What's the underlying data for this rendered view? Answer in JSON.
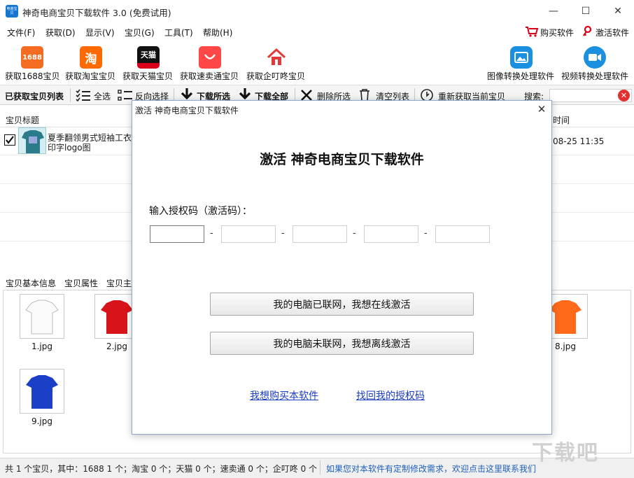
{
  "window": {
    "title": "神奇电商宝贝下载软件 3.0 (免费试用)",
    "logo_text": "电商宝贝",
    "controls": [
      "—",
      "☐",
      "✕"
    ]
  },
  "menu": [
    "文件(F)",
    "获取(D)",
    "显示(V)",
    "宝贝(G)",
    "工具(T)",
    "帮助(H)"
  ],
  "menu_right": {
    "buy": "购买软件",
    "activate": "激活软件"
  },
  "toolbar": {
    "items": [
      {
        "label": "获取1688宝贝",
        "icon_text": "1688",
        "color": "#f36c21"
      },
      {
        "label": "获取淘宝宝贝",
        "icon_text": "淘",
        "color": "#ff6a00"
      },
      {
        "label": "获取天猫宝贝",
        "icon_text": "天猫",
        "color": "#d9001b"
      },
      {
        "label": "获取速卖通宝贝",
        "icon_text": "",
        "color": "#ff4747"
      },
      {
        "label": "获取企叮咚宝贝",
        "icon_text": "",
        "color": "#e23a3a"
      }
    ],
    "right_items": [
      {
        "label": "图像转换处理软件",
        "color": "#1b8fe0"
      },
      {
        "label": "视频转换处理软件",
        "color": "#1b8fe0"
      }
    ]
  },
  "subbar": {
    "list_title": "已获取宝贝列表",
    "select_all": "全选",
    "invert": "反向选择",
    "download_selected": "下载所选",
    "download_all": "下载全部",
    "delete_selected": "删除所选",
    "clear_list": "清空列表",
    "refetch": "重新获取当前宝贝",
    "search_label": "搜索:"
  },
  "list": {
    "col_title": "宝贝标题",
    "col_time_fragment": "时间",
    "row": {
      "title_line1": "夏季翻领男式短袖工衣",
      "title_line2": "印字logo图",
      "time_fragment": "08-25 11:35"
    }
  },
  "tabs": [
    "宝贝基本信息",
    "宝贝属性",
    "宝贝主"
  ],
  "images": [
    {
      "label": "1.jpg",
      "color": "#ffffff"
    },
    {
      "label": "2.jpg",
      "color": "#d8141b"
    },
    {
      "label": "8.jpg",
      "color": "#ff6a1a"
    },
    {
      "label": "9.jpg",
      "color": "#1c3fc7"
    }
  ],
  "status": {
    "left": "共 1 个宝贝，其中：1688 1 个；淘宝 0 个；天猫 0 个；速卖通 0 个；企叮咚 0 个",
    "link": "如果您对本软件有定制修改需求，欢迎点击这里联系我们"
  },
  "dialog": {
    "title": "激活 神奇电商宝贝下载软件",
    "heading": "激活 神奇电商宝贝下载软件",
    "prompt": "输入授权码（激活码）：",
    "code_values": [
      "",
      "",
      "",
      "",
      ""
    ],
    "separator": "-",
    "online_button": "我的电脑已联网，我想在线激活",
    "offline_button": "我的电脑未联网，我想离线激活",
    "buy_link": "我想购买本软件",
    "recover_link": "找回我的授权码"
  },
  "watermark": "下载吧"
}
